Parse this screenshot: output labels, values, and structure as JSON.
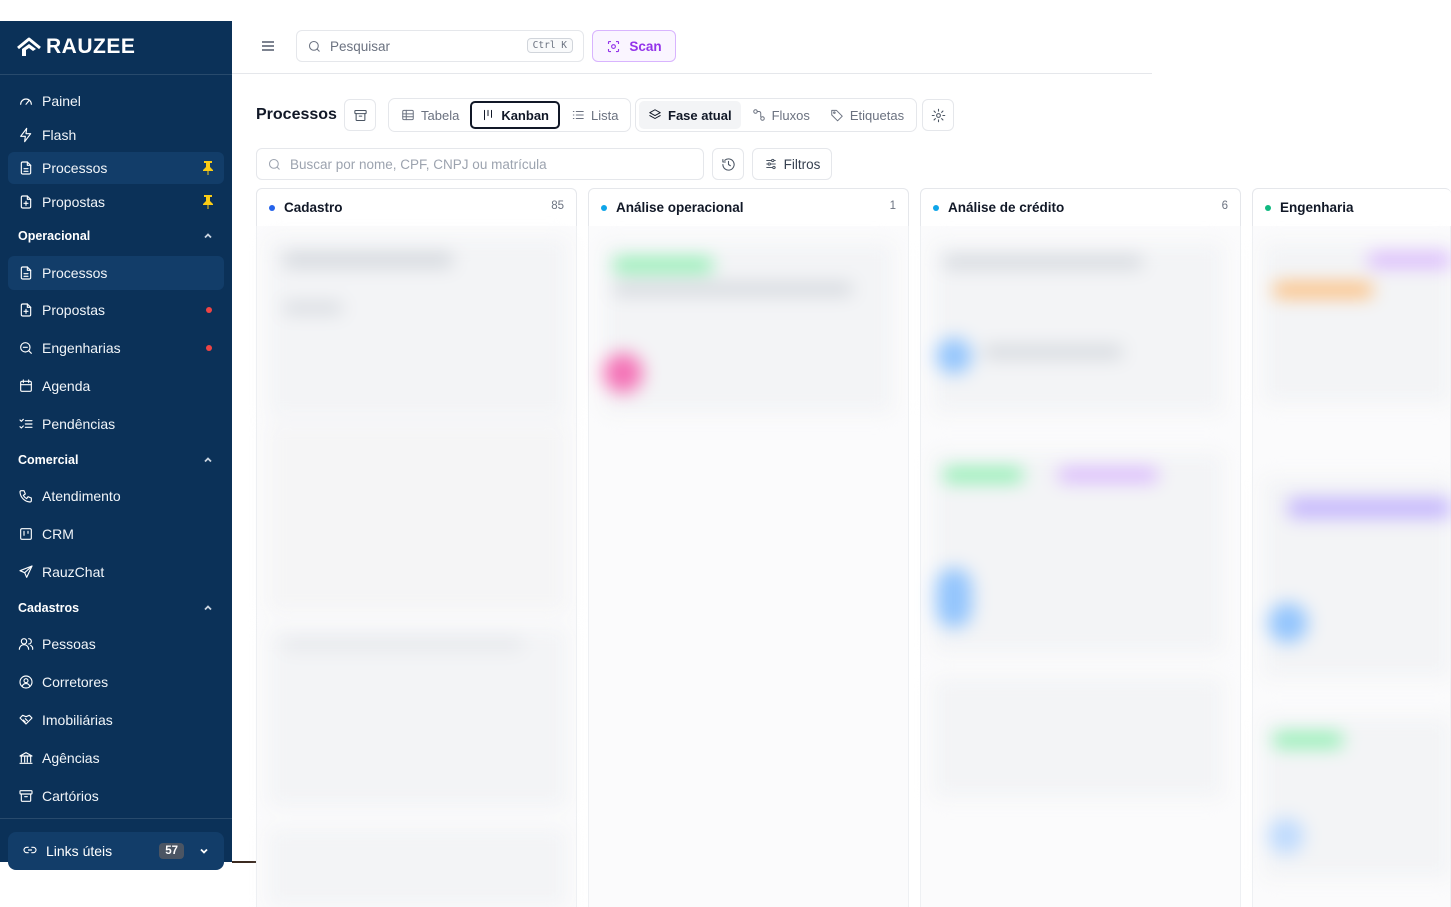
{
  "sidebar": {
    "logo": "RAUZEE",
    "top_items": [
      {
        "label": "Painel",
        "icon": "gauge-icon"
      },
      {
        "label": "Flash",
        "icon": "lightning-icon"
      },
      {
        "label": "Processos",
        "icon": "document-icon",
        "pinned": true,
        "active": true
      },
      {
        "label": "Propostas",
        "icon": "document-add-icon",
        "pinned": true
      }
    ],
    "sections": [
      {
        "title": "Operacional",
        "items": [
          {
            "label": "Processos",
            "icon": "document-icon",
            "active": true
          },
          {
            "label": "Propostas",
            "icon": "document-add-icon",
            "dot": true
          },
          {
            "label": "Engenharias",
            "icon": "magnifier-icon",
            "dot": true
          },
          {
            "label": "Agenda",
            "icon": "calendar-icon"
          },
          {
            "label": "Pendências",
            "icon": "checklist-icon"
          }
        ]
      },
      {
        "title": "Comercial",
        "items": [
          {
            "label": "Atendimento",
            "icon": "phone-icon"
          },
          {
            "label": "CRM",
            "icon": "kanban-icon"
          },
          {
            "label": "RauzChat",
            "icon": "send-icon"
          }
        ]
      },
      {
        "title": "Cadastros",
        "items": [
          {
            "label": "Pessoas",
            "icon": "users-icon"
          },
          {
            "label": "Corretores",
            "icon": "user-circle-icon"
          },
          {
            "label": "Imobiliárias",
            "icon": "handshake-icon"
          },
          {
            "label": "Agências",
            "icon": "bank-icon"
          },
          {
            "label": "Cartórios",
            "icon": "archive-icon"
          }
        ]
      }
    ],
    "links": {
      "label": "Links úteis",
      "count": "57"
    }
  },
  "topbar": {
    "search_placeholder": "Pesquisar",
    "shortcut": "Ctrl K",
    "scan_label": "Scan"
  },
  "toolbar": {
    "title": "Processos",
    "views": [
      {
        "label": "Tabela",
        "icon": "table-icon"
      },
      {
        "label": "Kanban",
        "icon": "kanban-icon",
        "selected": true
      },
      {
        "label": "Lista",
        "icon": "list-icon"
      }
    ],
    "groupings": [
      {
        "label": "Fase atual",
        "icon": "layers-icon",
        "selected": true
      },
      {
        "label": "Fluxos",
        "icon": "flow-icon"
      },
      {
        "label": "Etiquetas",
        "icon": "tag-icon"
      }
    ],
    "search_placeholder": "Buscar por nome, CPF, CNPJ ou matrícula",
    "filters_label": "Filtros"
  },
  "kanban": {
    "columns": [
      {
        "title": "Cadastro",
        "count": "85",
        "color": "#2563eb"
      },
      {
        "title": "Análise operacional",
        "count": "1",
        "color": "#0ea5e9"
      },
      {
        "title": "Análise de crédito",
        "count": "6",
        "color": "#0ea5e9"
      },
      {
        "title": "Engenharia",
        "count": "",
        "color": "#10b981"
      }
    ]
  },
  "colors": {
    "sidebar_bg": "#0b3158",
    "accent_purple": "#9333ea",
    "pin_yellow": "#facc15",
    "dot_red": "#ef4444"
  }
}
